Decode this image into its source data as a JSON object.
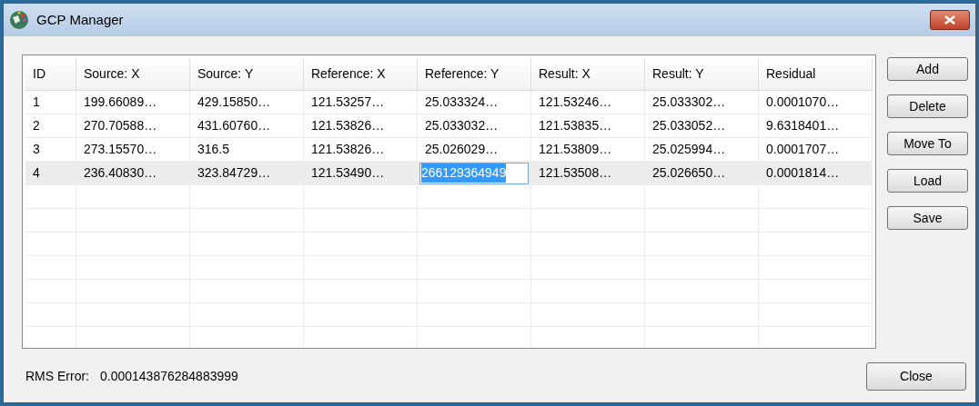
{
  "window": {
    "title": "GCP Manager"
  },
  "table": {
    "columns": [
      "ID",
      "Source: X",
      "Source: Y",
      "Reference: X",
      "Reference: Y",
      "Result: X",
      "Result: Y",
      "Residual"
    ],
    "rows": [
      {
        "selected": false,
        "cells": [
          {
            "text": "1",
            "editing": false
          },
          {
            "text": "199.66089…",
            "editing": false
          },
          {
            "text": "429.15850…",
            "editing": false
          },
          {
            "text": "121.53257…",
            "editing": false
          },
          {
            "text": "25.033324…",
            "editing": false
          },
          {
            "text": "121.53246…",
            "editing": false
          },
          {
            "text": "25.033302…",
            "editing": false
          },
          {
            "text": "0.0001070…",
            "editing": false
          }
        ]
      },
      {
        "selected": false,
        "cells": [
          {
            "text": "2",
            "editing": false
          },
          {
            "text": "270.70588…",
            "editing": false
          },
          {
            "text": "431.60760…",
            "editing": false
          },
          {
            "text": "121.53826…",
            "editing": false
          },
          {
            "text": "25.033032…",
            "editing": false
          },
          {
            "text": "121.53835…",
            "editing": false
          },
          {
            "text": "25.033052…",
            "editing": false
          },
          {
            "text": "9.6318401…",
            "editing": false
          }
        ]
      },
      {
        "selected": false,
        "cells": [
          {
            "text": "3",
            "editing": false
          },
          {
            "text": "273.15570…",
            "editing": false
          },
          {
            "text": "316.5",
            "editing": false
          },
          {
            "text": "121.53826…",
            "editing": false
          },
          {
            "text": "25.026029…",
            "editing": false
          },
          {
            "text": "121.53809…",
            "editing": false
          },
          {
            "text": "25.025994…",
            "editing": false
          },
          {
            "text": "0.0001707…",
            "editing": false
          }
        ]
      },
      {
        "selected": true,
        "cells": [
          {
            "text": "4",
            "editing": false
          },
          {
            "text": "236.40830…",
            "editing": false
          },
          {
            "text": "323.84729…",
            "editing": false
          },
          {
            "text": "121.53490…",
            "editing": false
          },
          {
            "text": "266129364949",
            "editing": true
          },
          {
            "text": "121.53508…",
            "editing": false
          },
          {
            "text": "25.026650…",
            "editing": false
          },
          {
            "text": "0.0001814…",
            "editing": false
          }
        ]
      }
    ]
  },
  "side_buttons": [
    "Add",
    "Delete",
    "Move To",
    "Load",
    "Save"
  ],
  "rms": {
    "label": "RMS Error:",
    "value": "0.000143876284883999"
  },
  "close_button": "Close"
}
